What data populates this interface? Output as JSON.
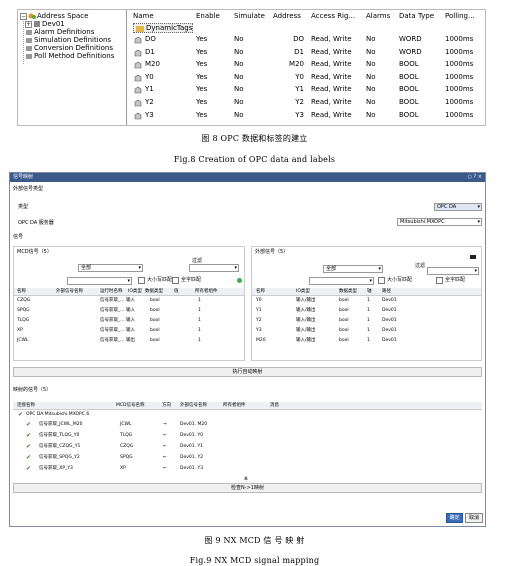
{
  "fig8": {
    "tree": [
      "Address Space",
      "Dev01",
      "Alarm Definitions",
      "Simulation Definitions",
      "Conversion Definitions",
      "Poll Method Definitions"
    ],
    "columns": [
      "Name",
      "Enable",
      "Simulate",
      "Address",
      "Access Rig...",
      "Alarms",
      "Data Type",
      "Polling..."
    ],
    "dynamic_tags": "DynamicTags",
    "rows": [
      [
        "DO",
        "Yes",
        "No",
        "DO",
        "Read, Write",
        "No",
        "WORD",
        "1000ms"
      ],
      [
        "D1",
        "Yes",
        "No",
        "D1",
        "Read, Write",
        "No",
        "WORD",
        "1000ms"
      ],
      [
        "M20",
        "Yes",
        "No",
        "M20",
        "Read, Write",
        "No",
        "BOOL",
        "1000ms"
      ],
      [
        "Y0",
        "Yes",
        "No",
        "Y0",
        "Read, Write",
        "No",
        "BOOL",
        "1000ms"
      ],
      [
        "Y1",
        "Yes",
        "No",
        "Y1",
        "Read, Write",
        "No",
        "BOOL",
        "1000ms"
      ],
      [
        "Y2",
        "Yes",
        "No",
        "Y2",
        "Read, Write",
        "No",
        "BOOL",
        "1000ms"
      ],
      [
        "Y3",
        "Yes",
        "No",
        "Y3",
        "Read, Write",
        "No",
        "BOOL",
        "1000ms"
      ]
    ],
    "caption_cn": "图 8 OPC 数据和标签的建立",
    "caption_en": "Fig.8 Creation of OPC data and labels"
  },
  "fig9": {
    "title": "信号映射",
    "title_controls": "○ ? ×",
    "ext_type_section": "外部信号类型",
    "type_label": "类型",
    "type_value": "OPC DA",
    "server_label": "OPC DA 服务器",
    "server_value": "Mitsubishi.MXOPC",
    "signal_section": "信号",
    "mcd_signals": "MCD信号（5）",
    "ext_signals": "外部信号（5）",
    "filter_all": "全部",
    "filter_label": "过滤",
    "match_case": "大小写匹配",
    "whole_word": "全字匹配",
    "mcd_cols": [
      "名称",
      "外部信号名称",
      "运行时名称",
      "IO类型",
      "数据类型",
      "值",
      "所有者组件"
    ],
    "mcd_rows": [
      [
        "CZQG",
        "信号获取_...",
        "输入",
        "bool",
        "1"
      ],
      [
        "SPQG",
        "信号获取_...",
        "输入",
        "bool",
        "1"
      ],
      [
        "TLQG",
        "信号获取_...",
        "输入",
        "bool",
        "1"
      ],
      [
        "XP",
        "信号获取_...",
        "输入",
        "bool",
        "1"
      ],
      [
        "JCWL",
        "信号获取_...",
        "输出",
        "bool",
        "1"
      ]
    ],
    "ext_cols": [
      "名称",
      "IO类型",
      "数据类型",
      "轴",
      "路径"
    ],
    "ext_rows": [
      [
        "Y0",
        "输入/输出",
        "bool",
        "1",
        "Dev01"
      ],
      [
        "Y1",
        "输入/输出",
        "bool",
        "1",
        "Dev01"
      ],
      [
        "Y2",
        "输入/输出",
        "bool",
        "1",
        "Dev01"
      ],
      [
        "Y3",
        "输入/输出",
        "bool",
        "1",
        "Dev01"
      ],
      [
        "M20",
        "输入/输出",
        "bool",
        "1",
        "Dev01"
      ]
    ],
    "auto_map": "执行自动映射",
    "mapped_section": "映射的信号（5）",
    "map_cols": [
      "连接名称",
      "MCD信号名称",
      "方向",
      "外部信号名称",
      "所有者组件",
      "消息"
    ],
    "map_root": "OPC DA:Mitsubishi.MXOPC.6",
    "map_rows": [
      [
        "信号获取_JCWL_M20",
        "JCWL",
        "→",
        "Dev01. M20"
      ],
      [
        "信号获取_TLQG_Y0",
        "TLQG",
        "←",
        "Dev01. Y0"
      ],
      [
        "信号获取_CZQG_Y1",
        "CZQG",
        "←",
        "Dev01. Y1"
      ],
      [
        "信号获取_SPQG_Y2",
        "SPQG",
        "←",
        "Dev01. Y2"
      ],
      [
        "信号获取_XP_Y3",
        "XP",
        "←",
        "Dev01. Y3"
      ]
    ],
    "check_map": "检查N->1映射",
    "ok": "确定",
    "cancel": "取消",
    "caption_cn": "图 9 NX MCD 信 号 映 射",
    "caption_en": "Fig.9 NX MCD signal mapping"
  }
}
